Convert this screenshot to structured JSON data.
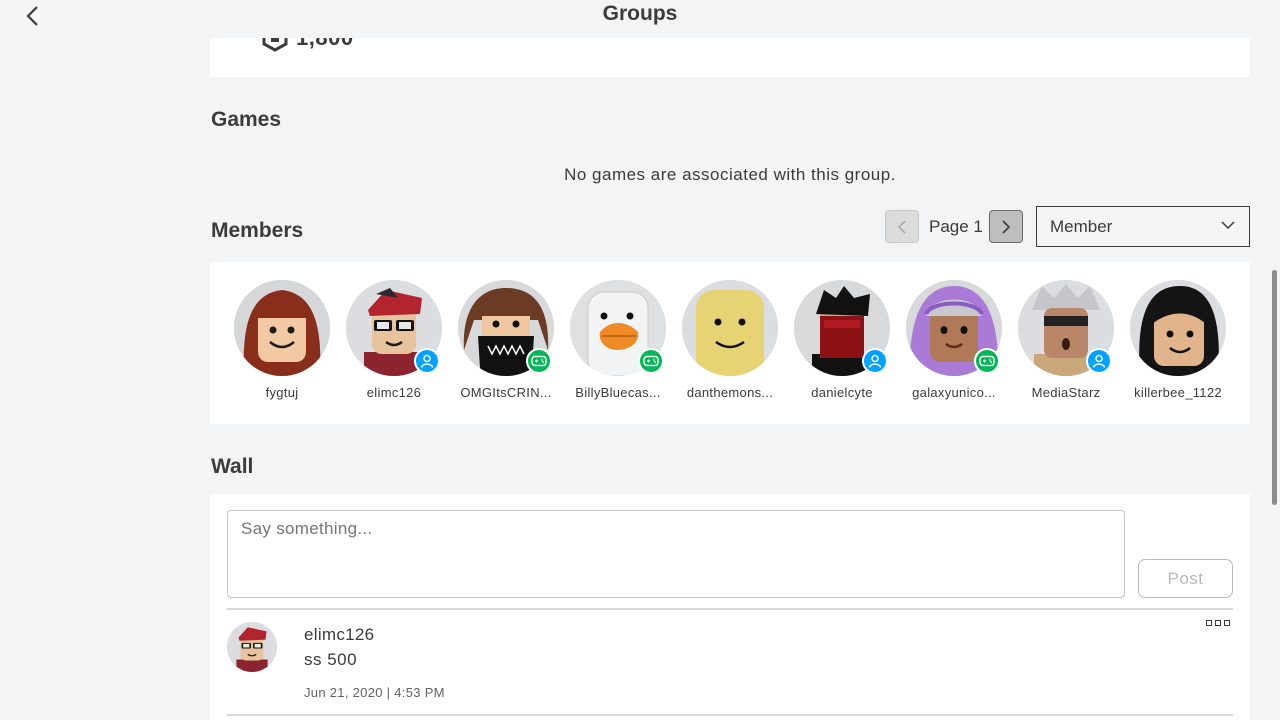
{
  "header": {
    "title": "Groups",
    "back_icon": "chevron-left-icon"
  },
  "funds": {
    "amount": "1,800",
    "icon": "robux-icon"
  },
  "games": {
    "title": "Games",
    "empty_message": "No games are associated with this group."
  },
  "members": {
    "title": "Members",
    "page_label": "Page 1",
    "role_selected": "Member",
    "list": [
      {
        "name": "fygtuj",
        "badge": ""
      },
      {
        "name": "elimc126",
        "badge": "online"
      },
      {
        "name": "OMGItsCRIN...",
        "badge": "in-game"
      },
      {
        "name": "BillyBluecas...",
        "badge": "in-game"
      },
      {
        "name": "danthemons...",
        "badge": ""
      },
      {
        "name": "danielcyte",
        "badge": "online"
      },
      {
        "name": "galaxyunico...",
        "badge": "in-game"
      },
      {
        "name": "MediaStarz",
        "badge": "online"
      },
      {
        "name": "killerbee_1122",
        "badge": ""
      }
    ]
  },
  "wall": {
    "title": "Wall",
    "input_placeholder": "Say something...",
    "post_label": "Post",
    "posts": [
      {
        "user": "elimc126",
        "body": "ss 500",
        "timestamp": "Jun 21, 2020 | 4:53 PM"
      }
    ]
  },
  "colors": {
    "online_badge": "#00a2ff",
    "ingame_badge": "#02b757",
    "background": "#f2f4f5"
  }
}
